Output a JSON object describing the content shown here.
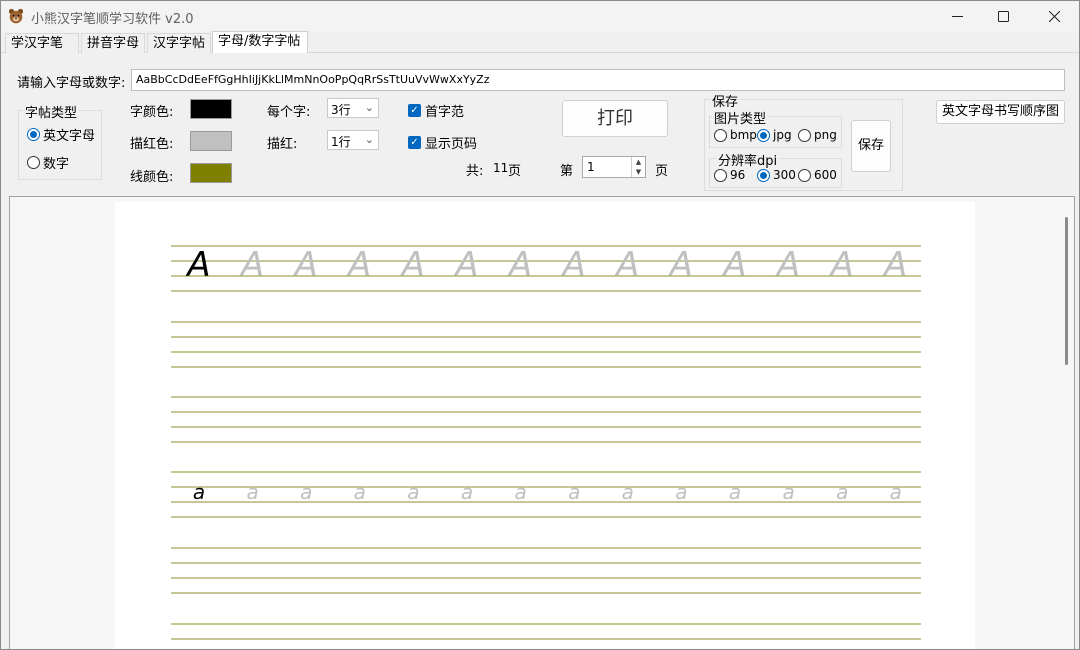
{
  "window": {
    "title": "小熊汉字笔顺学习软件 v2.0",
    "minimize_icon": "minimize-icon",
    "maximize_icon": "maximize-icon",
    "close_icon": "close-icon"
  },
  "tabs": [
    {
      "label": "学汉字笔顺"
    },
    {
      "label": "拼音字母"
    },
    {
      "label": "汉字字帖"
    },
    {
      "label": "字母/数字字帖",
      "active": true
    }
  ],
  "input": {
    "label": "请输入字母或数字:",
    "value": "AaBbCcDdEeFfGgHhIiJjKkLlMmNnOoPpQqRrSsTtUuVvWwXxYyZz"
  },
  "type_group": {
    "title": "字帖类型",
    "options": [
      {
        "label": "英文字母",
        "selected": true
      },
      {
        "label": "数字",
        "selected": false
      }
    ]
  },
  "colors": {
    "char_label": "字颜色:",
    "char_color": "#000000",
    "trace_label": "描红色:",
    "trace_color": "#c0c0c0",
    "line_label": "线颜色:",
    "line_color": "#808000"
  },
  "per_char": {
    "label": "每个字:",
    "value": "3行"
  },
  "trace": {
    "label": "描红:",
    "value": "1行"
  },
  "checks": [
    {
      "label": "首字范",
      "checked": true
    },
    {
      "label": "显示页码",
      "checked": true
    }
  ],
  "print": {
    "label": "打印"
  },
  "pages": {
    "total_label": "共:",
    "total": "11",
    "unit": "页",
    "page_label": "第",
    "page": "1",
    "page_unit": "页"
  },
  "save": {
    "title": "保存",
    "image_type_title": "图片类型",
    "image_types": [
      {
        "label": "bmp",
        "selected": false
      },
      {
        "label": "jpg",
        "selected": true
      },
      {
        "label": "png",
        "selected": false
      }
    ],
    "dpi_title": "分辨率dpi",
    "dpis": [
      {
        "label": "96",
        "selected": false
      },
      {
        "label": "300",
        "selected": true
      },
      {
        "label": "600",
        "selected": false
      }
    ],
    "button": "保存"
  },
  "stroke_order_button": "英文字母书写顺序图",
  "preview": {
    "rows": [
      {
        "char": "A",
        "copies": 14
      },
      {
        "char": "a",
        "copies": 14
      }
    ],
    "line_color": "#8f8f2a"
  }
}
